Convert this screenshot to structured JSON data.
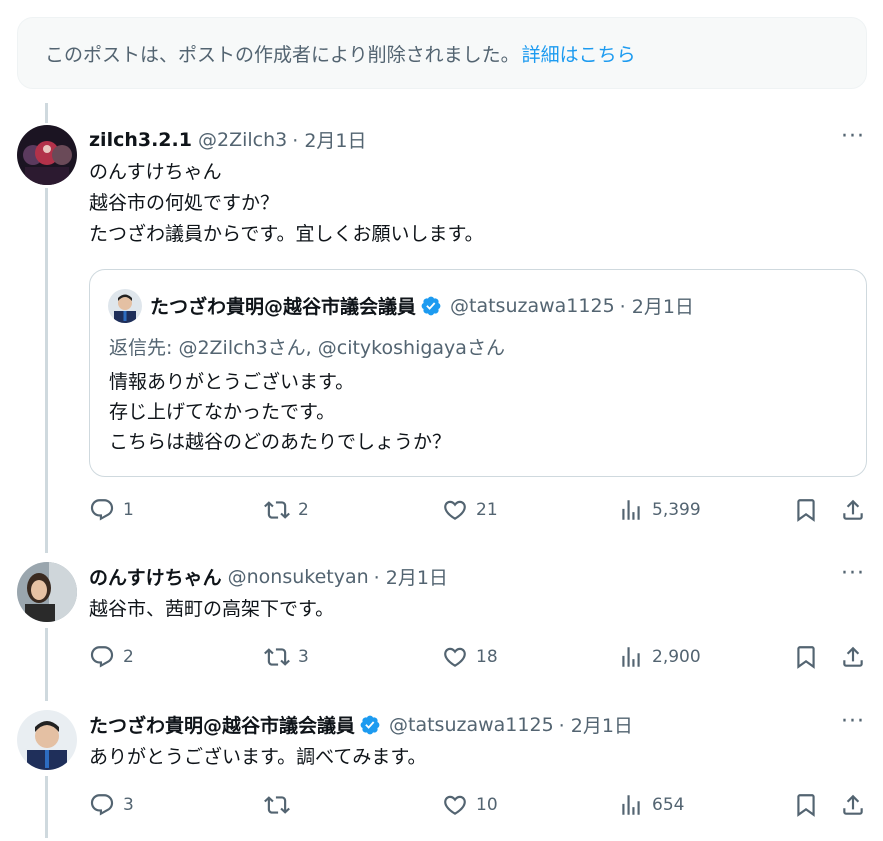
{
  "deleted_notice": {
    "text": "このポストは、ポストの作成者により削除されました。",
    "link": "詳細はこちら"
  },
  "tweets": [
    {
      "name": "zilch3.2.1",
      "handle": "@2Zilch3",
      "date": "· 2月1日",
      "text": "のんすけちゃん\n越谷市の何処ですか？\nたつざわ議員からです。宜しくお願いします。",
      "verified": false,
      "more": "···",
      "replies": "1",
      "reposts": "2",
      "likes": "21",
      "views": "5,399",
      "quote": {
        "name": "たつざわ貴明@越谷市議会議員",
        "handle": "@tatsuzawa1125",
        "date": "· 2月1日",
        "reply_to": "返信先: @2Zilch3さん, @citykoshigayaさん",
        "text": "情報ありがとうございます。\n存じ上げてなかったです。\nこちらは越谷のどのあたりでしょうか？"
      }
    },
    {
      "name": "のんすけちゃん",
      "handle": "@nonsuketyan",
      "date": "· 2月1日",
      "text": "越谷市、茜町の高架下です。",
      "verified": false,
      "more": "···",
      "replies": "2",
      "reposts": "3",
      "likes": "18",
      "views": "2,900"
    },
    {
      "name": "たつざわ貴明@越谷市議会議員",
      "handle": "@tatsuzawa1125",
      "date": "· 2月1日",
      "text": "ありがとうございます。調べてみます。",
      "verified": true,
      "more": "···",
      "replies": "3",
      "reposts": "",
      "likes": "10",
      "views": "654"
    }
  ],
  "colors": {
    "accent": "#1d9bf0",
    "secondary_text": "#536471",
    "primary_text": "#0f1419",
    "thread_line": "#cfd9de"
  }
}
